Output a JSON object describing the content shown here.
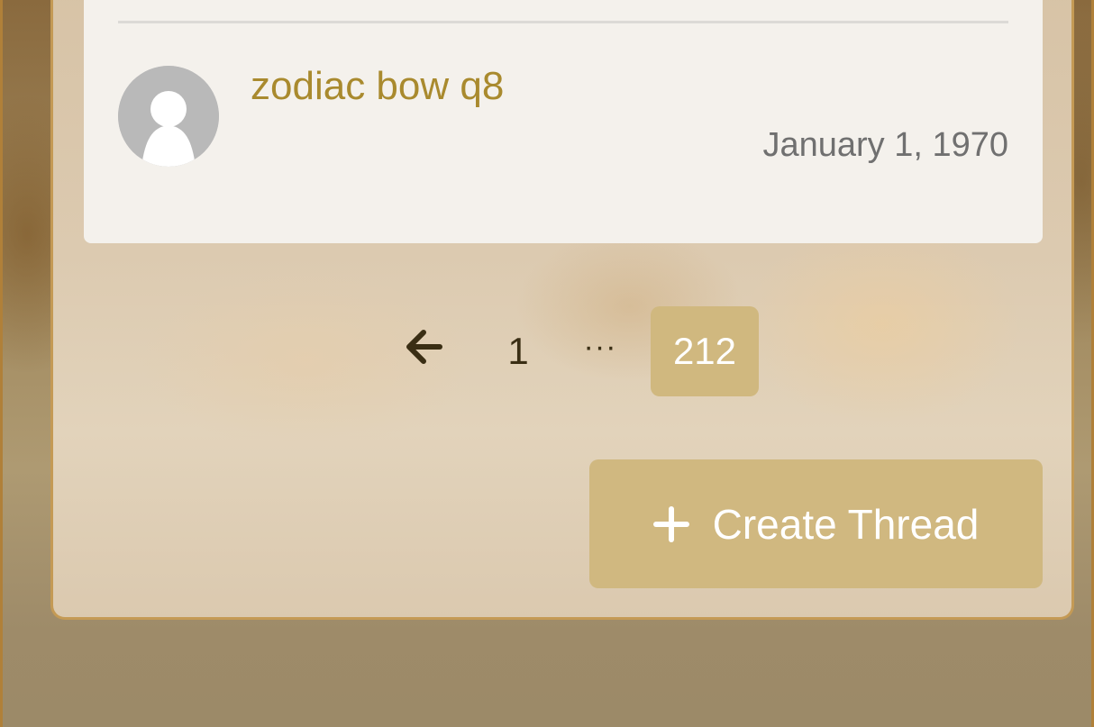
{
  "thread": {
    "title": "zodiac bow q8",
    "date": "January 1, 1970",
    "avatar_icon": "default-user-avatar"
  },
  "pagination": {
    "prev_icon": "arrow-left-icon",
    "first_page": "1",
    "ellipsis": "···",
    "current_page": "212"
  },
  "actions": {
    "create_thread_icon": "plus-icon",
    "create_thread_label": "Create Thread"
  },
  "colors": {
    "title": "#a98a2e",
    "button_bg": "#d0b880",
    "current_page_bg": "#d0b87f",
    "card_bg": "#f4f1ec"
  }
}
